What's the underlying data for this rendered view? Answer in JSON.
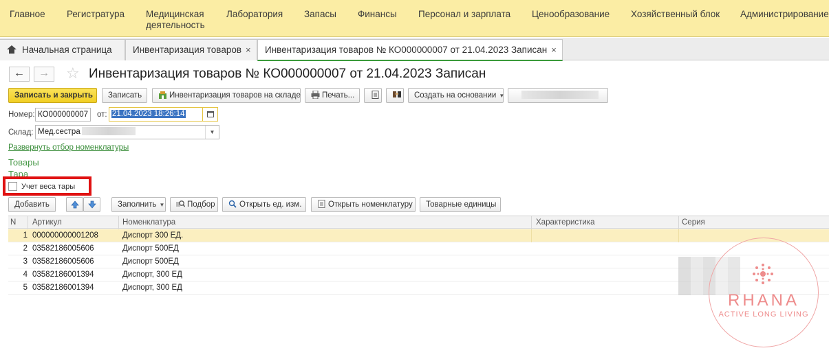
{
  "menu": [
    "Главное",
    "Регистратура",
    "Медицинская деятельность",
    "Лаборатория",
    "Запасы",
    "Финансы",
    "Персонал и зарплата",
    "Ценообразование",
    "Хозяйственный блок",
    "Администрирование"
  ],
  "tabs": [
    {
      "label": "Начальная страница"
    },
    {
      "label": "Инвентаризация товаров"
    },
    {
      "label": "Инвентаризация товаров № КО000000007 от 21.04.2023 Записан"
    }
  ],
  "tab_close": "×",
  "nav": {
    "back": "←",
    "forward": "→",
    "star": "☆"
  },
  "title": "Инвентаризация товаров № КО000000007 от 21.04.2023 Записан",
  "toolbar": {
    "save_close": "Записать и закрыть",
    "save": "Записать",
    "inventory": "Инвентаризация товаров на складе",
    "print": "Печать...",
    "create_based": "Создать на основании"
  },
  "form": {
    "number_label": "Номер:",
    "number_value": "КО000000007",
    "date_label": "от:",
    "date_value": "21.04.2023 18:26:14",
    "warehouse_label": "Склад:",
    "warehouse_value": "Мед.сестра"
  },
  "expand_filter_link": "Развернуть отбор номенклатуры",
  "sections": {
    "goods": "Товары",
    "tare": "Тара"
  },
  "tare_weight_checkbox": "Учет веса тары",
  "table_toolbar": {
    "add": "Добавить",
    "fill": "Заполнить",
    "pick": "Подбор",
    "open_unit": "Открыть ед. изм.",
    "open_nomenclature": "Открыть номенклатуру",
    "product_units": "Товарные единицы"
  },
  "table": {
    "columns": [
      "N",
      "Артикул",
      "Номенклатура",
      "Характеристика",
      "Серия"
    ],
    "rows": [
      {
        "n": "1",
        "article": "000000000001208",
        "name": "Диспорт 300 ЕД."
      },
      {
        "n": "2",
        "article": "03582186005606",
        "name": "Диспорт 500ЕД"
      },
      {
        "n": "3",
        "article": "03582186005606",
        "name": "Диспорт 500ЕД"
      },
      {
        "n": "4",
        "article": "03582186001394",
        "name": "Диспорт, 300 ЕД"
      },
      {
        "n": "5",
        "article": "03582186001394",
        "name": "Диспорт, 300 ЕД"
      }
    ]
  },
  "watermark": {
    "name": "RHANA",
    "tagline": "ACTIVE LONG LIVING",
    "color": "#ee8c8c"
  },
  "colors": {
    "menu_bg": "#fbeda4",
    "primary_button": "#f1cf24",
    "link": "#3b8e3b",
    "selected_row": "#fbefc0",
    "highlight": "#e01212"
  }
}
